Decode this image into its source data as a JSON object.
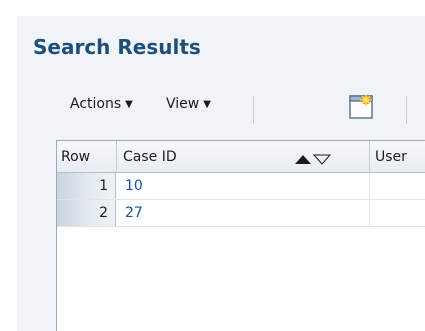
{
  "page": {
    "title": "Search Results"
  },
  "toolbar": {
    "actions_label": "Actions",
    "view_label": "View",
    "new_icon": "new-document-icon"
  },
  "table": {
    "columns": [
      "Row",
      "Case ID",
      "User"
    ],
    "sort": "ascending",
    "rows": [
      {
        "row": "1",
        "case_id": "10"
      },
      {
        "row": "2",
        "case_id": "27"
      }
    ]
  }
}
